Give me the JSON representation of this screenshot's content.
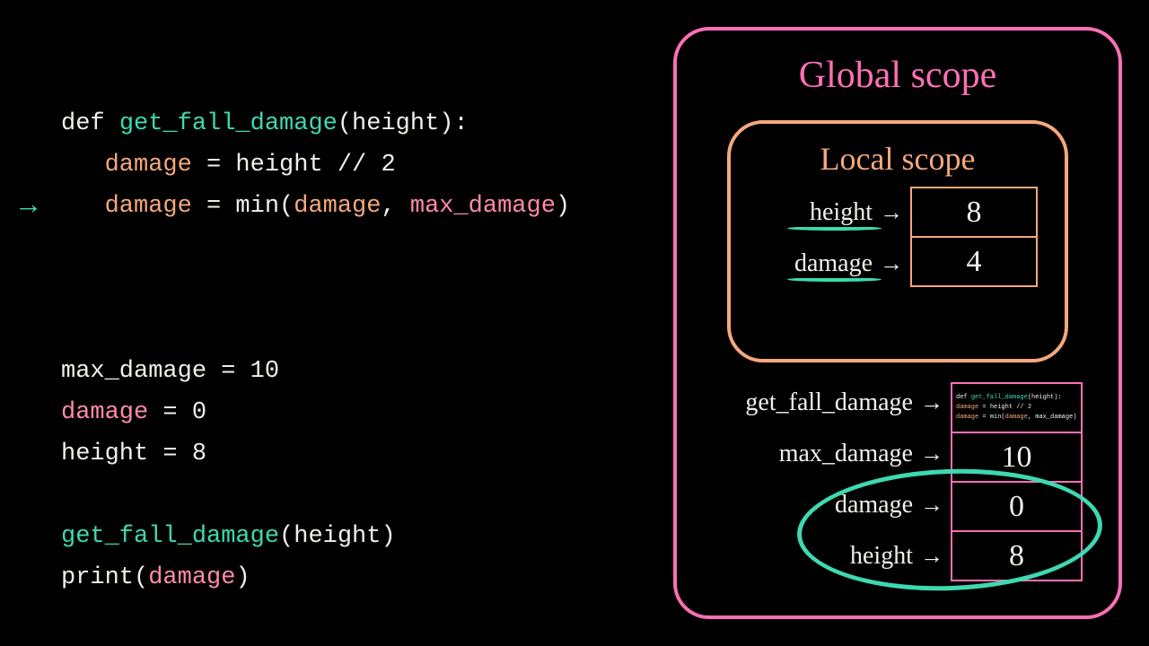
{
  "code": {
    "line1_def": "def ",
    "line1_fn": "get_fall_damage",
    "line1_rest": "(height):",
    "line2_indent": "   ",
    "line2_var": "damage",
    "line2_rest": " = height // 2",
    "line3_indent": "   ",
    "line3_var": "damage",
    "line3_mid": " = min(",
    "line3_arg1": "damage",
    "line3_comma": ", ",
    "line3_arg2": "max_damage",
    "line3_end": ")",
    "line5": "max_damage = 10",
    "line6_var": "damage",
    "line6_rest": " = 0",
    "line7": "height = 8",
    "line9_fn": "get_fall_damage",
    "line9_rest": "(height)",
    "line10_a": "print(",
    "line10_var": "damage",
    "line10_b": ")"
  },
  "exec_arrow": "→",
  "global": {
    "title": "Global scope",
    "labels": [
      "get_fall_damage",
      "max_damage",
      "damage",
      "height"
    ],
    "values": [
      "",
      "10",
      "0",
      "8"
    ],
    "funcbody": {
      "l1a": "def ",
      "l1b": "get_fall_damage",
      "l1c": "(height):",
      "l2a": "damage",
      "l2b": " = height // 2",
      "l3a": "damage",
      "l3b": " = min(",
      "l3c": "damage",
      "l3d": ", max_damage)"
    }
  },
  "local": {
    "title": "Local scope",
    "labels": [
      "height",
      "damage"
    ],
    "values": [
      "8",
      "4"
    ]
  },
  "lbl_arrow": "→"
}
